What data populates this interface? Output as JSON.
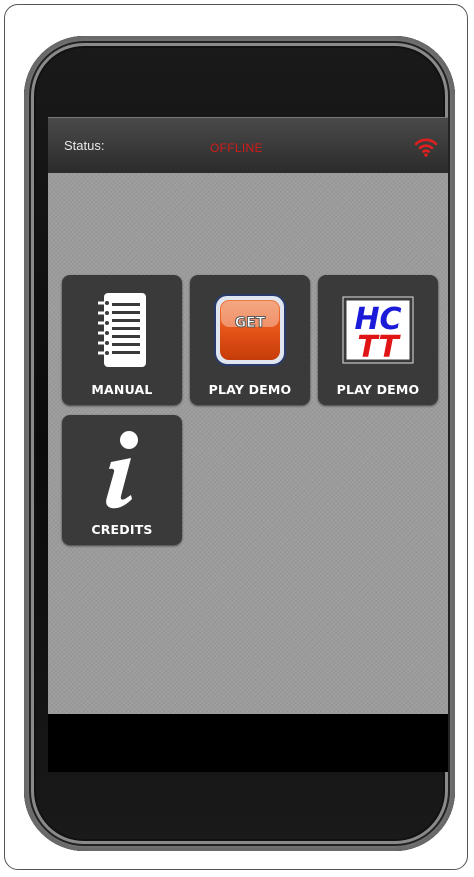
{
  "status": {
    "label": "Status:",
    "value": "OFFLINE",
    "value_color": "#d21a1a",
    "icon": "wifi-icon"
  },
  "tiles": [
    {
      "label": "MANUAL",
      "icon": "notebook-icon"
    },
    {
      "label": "PLAY DEMO",
      "icon": "get-game-icon",
      "icon_text": "GET"
    },
    {
      "label": "PLAY DEMO",
      "icon": "hctt-game-icon",
      "icon_text_top": "HC",
      "icon_text_bottom": "TT"
    },
    {
      "label": "CREDITS",
      "icon": "info-icon"
    }
  ]
}
